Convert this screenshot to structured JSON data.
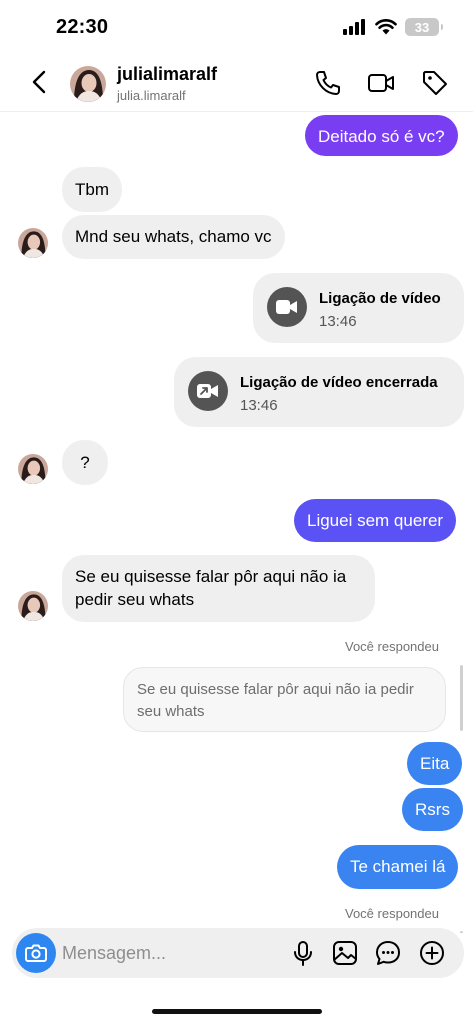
{
  "status_bar": {
    "time": "22:30",
    "battery": "33",
    "icons": [
      "signal-icon",
      "wifi-icon",
      "battery-icon"
    ]
  },
  "header": {
    "name": "julialimaralf",
    "username": "julia.limaralf",
    "icons": [
      "back-arrow-icon",
      "phone-icon",
      "video-camera-icon",
      "tag-icon"
    ]
  },
  "messages": {
    "m1": "Deitado só é vc?",
    "m2": "Tbm",
    "m3": "Mnd seu whats, chamo vc",
    "call1": {
      "title": "Ligação de vídeo",
      "time": "13:46"
    },
    "call2": {
      "title": "Ligação de vídeo encerrada",
      "time": "13:46"
    },
    "m4": "?",
    "m5": "Liguei sem querer",
    "m6": "Se eu quisesse falar pôr aqui não ia pedir seu whats",
    "replied_label_1": "Você respondeu",
    "reply_quote": "Se eu quisesse falar pôr aqui não ia pedir seu whats",
    "m7": "Eita",
    "m8": "Rsrs",
    "m9": "Te chamei lá",
    "replied_label_2": "Você respondeu"
  },
  "composer": {
    "placeholder": "Mensagem...",
    "icons": [
      "camera-icon",
      "microphone-icon",
      "gallery-icon",
      "sticker-icon",
      "plus-icon"
    ]
  },
  "colors": {
    "outgoing_purple": "#7a3ef2",
    "outgoing_indigo": "#5b52f5",
    "outgoing_blue": "#3a84f2",
    "incoming_gray": "#efefef",
    "camera_button": "#2e87f0"
  }
}
